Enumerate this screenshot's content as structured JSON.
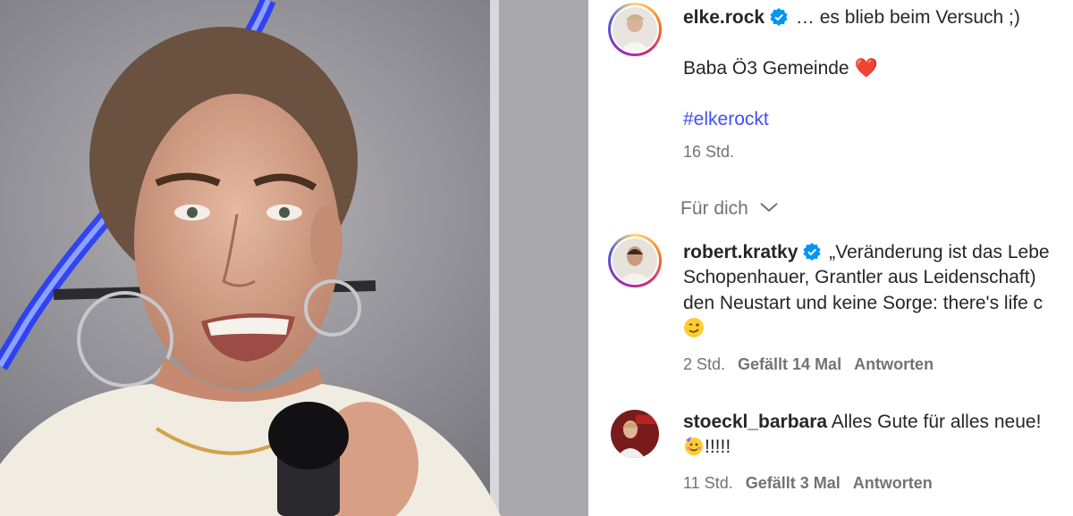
{
  "post": {
    "username": "elke.rock",
    "caption_line1": "… es blieb beim Versuch ;)",
    "caption_line2": "Baba Ö3 Gemeinde",
    "caption_heart": "❤️",
    "hashtag": "#elkerockt",
    "time": "16 Std."
  },
  "for_you": {
    "label": "Für dich"
  },
  "comments": [
    {
      "username": "robert.kratky",
      "verified": true,
      "lines": [
        "„Veränderung ist das Lebe",
        "Schopenhauer, Grantler aus Leidenschaft)",
        "den Neustart und keine Sorge: there's life c"
      ],
      "emoji": "wink-face-emoji",
      "time": "2 Std.",
      "likes": "Gefällt 14 Mal",
      "reply": "Antworten"
    },
    {
      "username": "stoeckl_barbara",
      "verified": false,
      "lines": [
        "Alles Gute für alles neue!"
      ],
      "emoji": "party-face-emoji",
      "emoji_suffix": "!!!!!",
      "time": "11 Std.",
      "likes": "Gefällt 3 Mal",
      "reply": "Antworten"
    }
  ],
  "colors": {
    "hashtag": "#4150f7",
    "verified": "#0095f6",
    "muted": "#737373",
    "text": "#262626"
  }
}
